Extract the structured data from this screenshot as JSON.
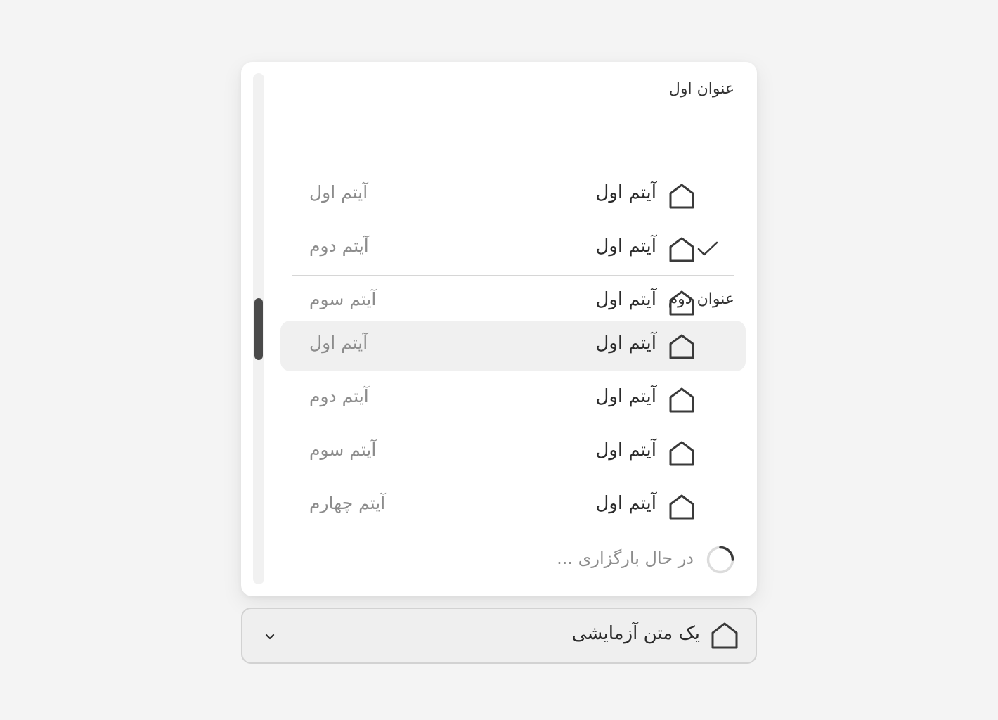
{
  "colors": {
    "page_background": "#f4f4f4",
    "menu_background": "#ffffff",
    "highlight_background": "#f0f0f0",
    "scroll_thumb": "#4a4a4a",
    "primary_text": "#2b2b2b",
    "secondary_text": "#8c8c8c"
  },
  "menu": {
    "groups": [
      {
        "title": "عنوان اول",
        "items": [
          {
            "label": "آیتم اول",
            "description": "آیتم اول",
            "icon": "home-icon",
            "selected": false,
            "highlighted": false
          },
          {
            "label": "آیتم اول",
            "description": "آیتم دوم",
            "icon": "home-icon",
            "selected": true,
            "highlighted": false
          },
          {
            "label": "آیتم اول",
            "description": "آیتم سوم",
            "icon": "home-icon",
            "selected": false,
            "highlighted": false
          }
        ]
      },
      {
        "title": "عنوان دوم",
        "items": [
          {
            "label": "آیتم اول",
            "description": "آیتم اول",
            "icon": "home-icon",
            "selected": false,
            "highlighted": true
          },
          {
            "label": "آیتم اول",
            "description": "آیتم دوم",
            "icon": "home-icon",
            "selected": false,
            "highlighted": false
          },
          {
            "label": "آیتم اول",
            "description": "آیتم سوم",
            "icon": "home-icon",
            "selected": false,
            "highlighted": false
          },
          {
            "label": "آیتم اول",
            "description": "آیتم چهارم",
            "icon": "home-icon",
            "selected": false,
            "highlighted": false
          }
        ]
      }
    ],
    "loading_text": "در حال بارگزاری ...",
    "selected_icon": "check-icon",
    "loading_icon": "spinner-icon"
  },
  "select": {
    "value": "یک متن آزمایشی",
    "icon": "home-icon",
    "toggle_icon": "chevron-down-icon"
  }
}
